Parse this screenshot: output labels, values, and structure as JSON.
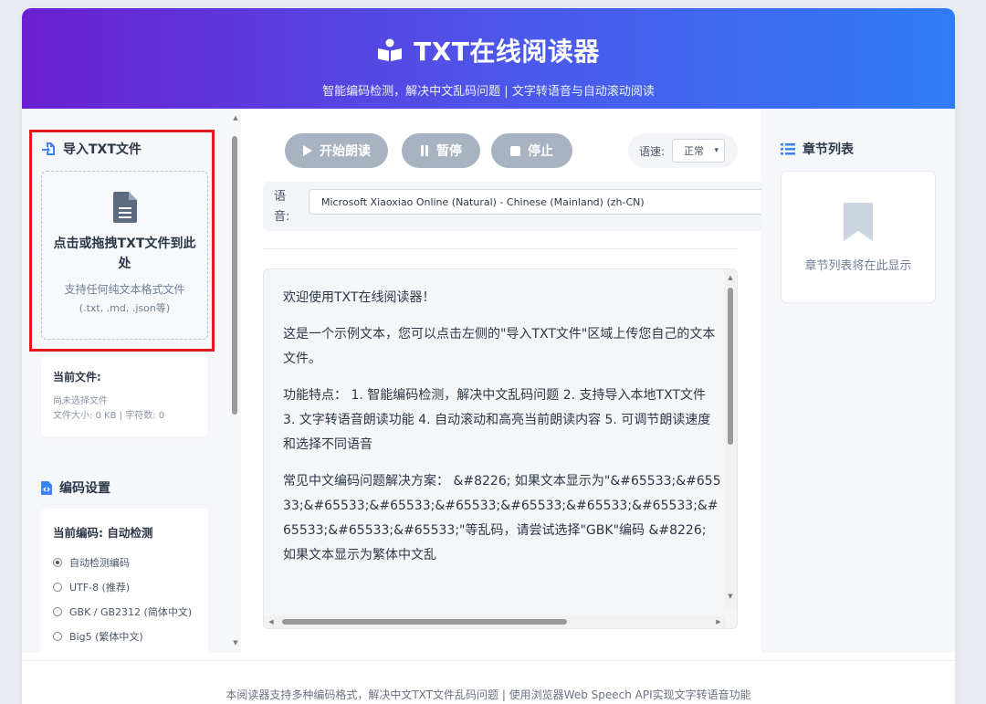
{
  "header": {
    "title": "TXT在线阅读器",
    "subtitle": "智能编码检测，解决中文乱码问题 | 文字转语音与自动滚动阅读"
  },
  "sidebar": {
    "import_title": "导入TXT文件",
    "dropzone_main": "点击或拖拽TXT文件到此处",
    "dropzone_hint": "支持任何纯文本格式文件",
    "dropzone_formats": "(.txt, .md, .json等)",
    "current_file_label": "当前文件:",
    "current_file_value": "尚未选择文件",
    "file_stats": "文件大小: 0 KB | 字符数: 0",
    "encoding_title": "编码设置",
    "current_encoding": "当前编码: 自动检测",
    "encoding_options": [
      {
        "label": "自动检测编码",
        "checked": true
      },
      {
        "label": "UTF-8 (推荐)",
        "checked": false
      },
      {
        "label": "GBK / GB2312 (简体中文)",
        "checked": false
      },
      {
        "label": "Big5 (繁体中文)",
        "checked": false
      }
    ]
  },
  "controls": {
    "play_label": "开始朗读",
    "pause_label": "暂停",
    "stop_label": "停止",
    "speed_label": "语速:",
    "speed_value": "正常",
    "voice_label": "语音:",
    "voice_value": "Microsoft Xiaoxiao Online (Natural) - Chinese (Mainland) (zh-CN)"
  },
  "reader": {
    "paragraphs": [
      "欢迎使用TXT在线阅读器！",
      "这是一个示例文本，您可以点击左侧的\"导入TXT文件\"区域上传您自己的文本文件。",
      "功能特点： 1. 智能编码检测，解决中文乱码问题 2. 支持导入本地TXT文件 3. 文字转语音朗读功能 4. 自动滚动和高亮当前朗读内容 5. 可调节朗读速度和选择不同语音",
      "常见中文编码问题解决方案： &#8226; 如果文本显示为\"&#65533;&#65533;&#65533;&#65533;&#65533;&#65533;&#65533;&#65533;&#65533;&#65533;&#65533;\"等乱码，请尝试选择\"GBK\"编码 &#8226; 如果文本显示为繁体中文乱"
    ]
  },
  "chapters": {
    "title": "章节列表",
    "empty_text": "章节列表将在此显示"
  },
  "footer": {
    "text": "本阅读器支持多种编码格式，解决中文TXT文件乱码问题 | 使用浏览器Web Speech API实现文字转语音功能"
  },
  "colors": {
    "header_start": "#6a1fd2",
    "header_end": "#2f7cf6",
    "accent_blue": "#3b82f6",
    "button_gray": "#a8b3c1",
    "highlight_red": "#e31b1b"
  }
}
